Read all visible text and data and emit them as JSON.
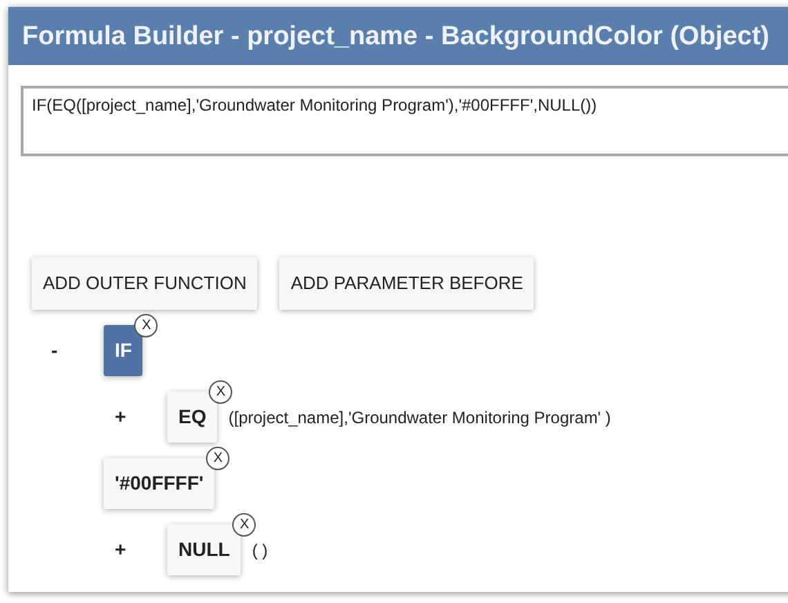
{
  "dialog": {
    "title": "Formula Builder - project_name - BackgroundColor (Object)"
  },
  "formula": {
    "value": "IF(EQ([project_name],'Groundwater Monitoring Program'),'#00FFFF',NULL())"
  },
  "buttons": [
    "ADD OUTER FUNCTION",
    "ADD PARAMETER BEFORE"
  ],
  "tree": [
    {
      "toggle": "-",
      "label": "IF",
      "close": "X",
      "selected": true,
      "children": [
        {
          "toggle": "+",
          "label": "EQ",
          "close": "X",
          "selected": false,
          "args": "([project_name],'Groundwater Monitoring Program' )"
        },
        {
          "label": "'#00FFFF'",
          "close": "X",
          "selected": false
        },
        {
          "toggle": "+",
          "label": "NULL",
          "close": "X",
          "selected": false,
          "args": "( )"
        }
      ]
    }
  ]
}
